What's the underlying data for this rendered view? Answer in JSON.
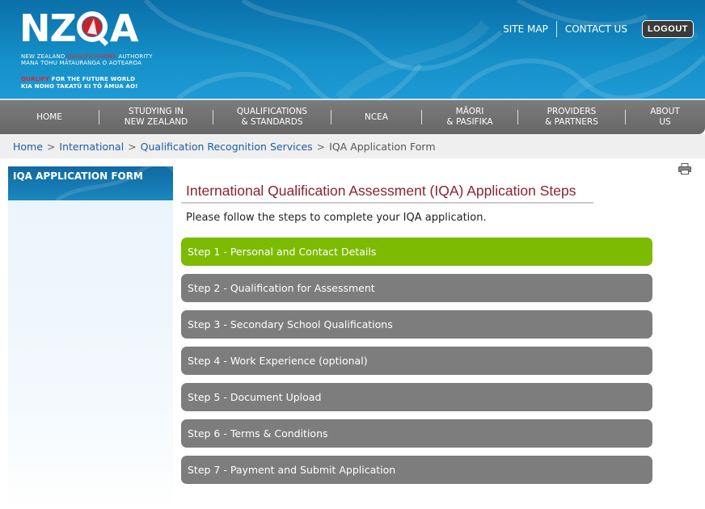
{
  "header": {
    "logo": {
      "wordmark_left": "NZ",
      "wordmark_right": "A",
      "line1_a": "NEW ZEALAND",
      "line1_red": "QUALIFICATIONS",
      "line1_b": "AUTHORITY",
      "line2": "MANA TOHU MĀTAURANGA O AOTEAROA",
      "line3_red": "QUALIFY",
      "line3_b": "FOR THE FUTURE WORLD",
      "line4": "KIA NOHO TAKATŪ KI TŌ ĀMUA AO!"
    },
    "links": {
      "site_map": "SITE MAP",
      "contact_us": "CONTACT US",
      "logout": "LOGOUT"
    }
  },
  "nav": {
    "items": [
      {
        "line1": "HOME",
        "line2": ""
      },
      {
        "line1": "STUDYING IN",
        "line2": "NEW ZEALAND"
      },
      {
        "line1": "QUALIFICATIONS",
        "line2": "& STANDARDS"
      },
      {
        "line1": "NCEA",
        "line2": ""
      },
      {
        "line1": "MĀORI",
        "line2": "& PASIFIKA"
      },
      {
        "line1": "PROVIDERS",
        "line2": "& PARTNERS"
      },
      {
        "line1": "ABOUT",
        "line2": "US"
      }
    ]
  },
  "breadcrumb": {
    "home": "Home",
    "international": "International",
    "qrs": "Qualification Recognition Services",
    "sep": ">",
    "current": "IQA Application Form"
  },
  "sidebar": {
    "title": "IQA APPLICATION FORM"
  },
  "main": {
    "title": "International Qualification Assessment (IQA) Application Steps",
    "intro": "Please follow the steps to complete your IQA application.",
    "steps": [
      "Step 1 - Personal and Contact Details",
      "Step 2 - Qualification for Assessment",
      "Step 3 - Secondary School Qualifications",
      "Step 4 - Work Experience (optional)",
      "Step 5 - Document Upload",
      "Step 6 - Terms & Conditions",
      "Step 7 - Payment and Submit Application"
    ],
    "active_step": 1,
    "colors": {
      "active_step": "#7cbb00",
      "inactive_step": "#7d7d7d",
      "title": "#8b2230"
    }
  }
}
